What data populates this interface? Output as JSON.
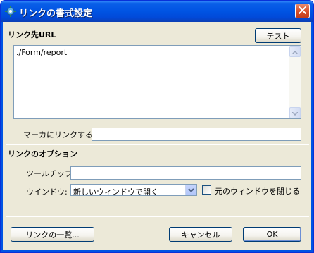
{
  "window": {
    "title": "リンクの書式設定"
  },
  "link_section": {
    "heading": "リンク先URL",
    "test_button": "テスト",
    "url_value": "./Form/report",
    "marker_label": "マーカにリンクする:",
    "marker_value": ""
  },
  "options_section": {
    "heading": "リンクのオプション",
    "tooltip_label": "ツールチップ:",
    "tooltip_value": "",
    "window_label": "ウインドウ:",
    "window_selected": "新しいウィンドウで開く",
    "close_original_label": "元のウィンドウを閉じる",
    "close_original_checked": false
  },
  "footer": {
    "link_list_button": "リンクの一覧...",
    "cancel_button": "キャンセル",
    "ok_button": "OK"
  },
  "colors": {
    "titlebar": "#0054e3",
    "dialog_bg": "#ece9d8",
    "input_border": "#7f9db9",
    "close_button": "#d9512b"
  },
  "icons": {
    "app": "gear-icon",
    "close": "close-icon",
    "scroll_up": "chevron-up-icon",
    "scroll_down": "chevron-down-icon",
    "dropdown": "chevron-down-icon"
  }
}
